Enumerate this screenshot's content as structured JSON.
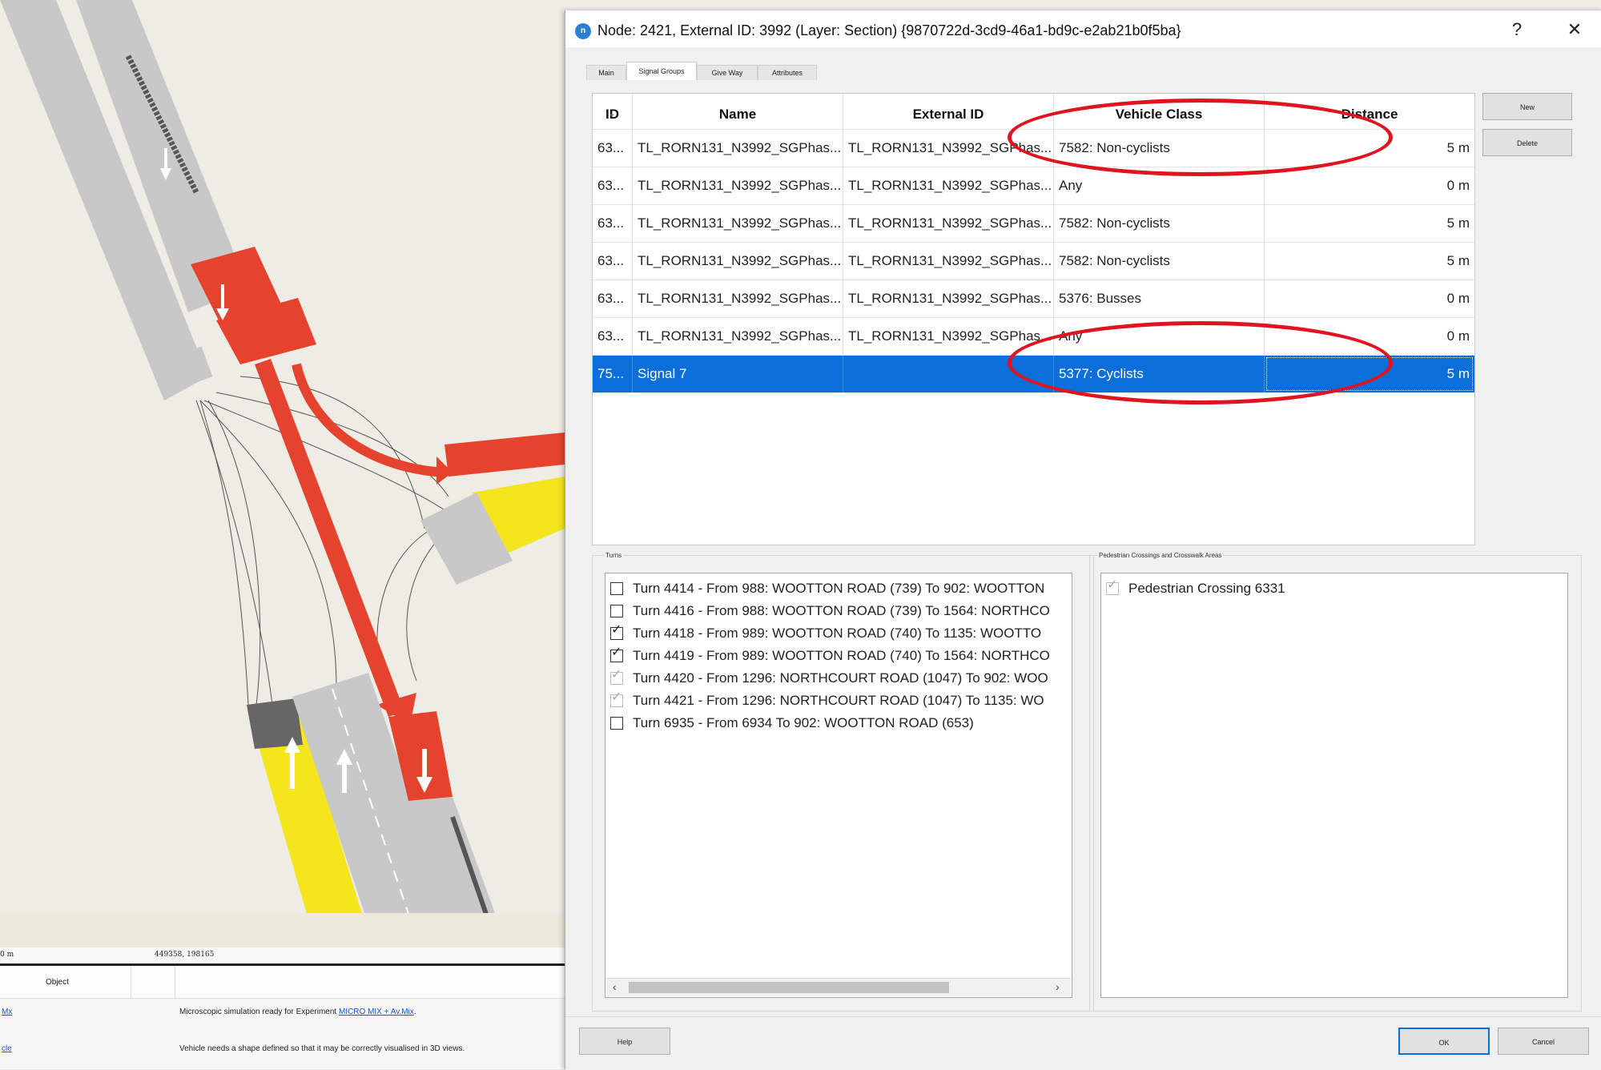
{
  "map": {
    "scale_label": "0 m",
    "coordinates": "449358, 198165"
  },
  "log": {
    "header_object": "Object",
    "rows": [
      {
        "link": "Mx",
        "message": "Microscopic simulation ready for Experiment",
        "message_link": "MICRO MIX + Av.Mix"
      },
      {
        "link": "cle",
        "message": "Vehicle needs a shape defined so that it may be correctly visualised in 3D views.",
        "message_link": ""
      }
    ]
  },
  "dialog": {
    "icon": "n",
    "title": "Node: 2421, External ID: 3992 (Layer: Section) {9870722d-3cd9-46a1-bd9c-e2ab21b0f5ba}",
    "help_label": "?",
    "close_label": "✕",
    "tabs": [
      "Main",
      "Signal Groups",
      "Give Way",
      "Attributes"
    ],
    "active_tab": "Signal Groups",
    "table": {
      "columns": [
        "ID",
        "Name",
        "External ID",
        "Vehicle Class",
        "Distance"
      ],
      "rows": [
        {
          "id": "63...",
          "name": "TL_RORN131_N3992_SGPhas...",
          "external": "TL_RORN131_N3992_SGPhas...",
          "vclass": "7582: Non-cyclists",
          "distance": "5 m",
          "selected": false
        },
        {
          "id": "63...",
          "name": "TL_RORN131_N3992_SGPhas...",
          "external": "TL_RORN131_N3992_SGPhas...",
          "vclass": "Any",
          "distance": "0 m",
          "selected": false
        },
        {
          "id": "63...",
          "name": "TL_RORN131_N3992_SGPhas...",
          "external": "TL_RORN131_N3992_SGPhas...",
          "vclass": "7582: Non-cyclists",
          "distance": "5 m",
          "selected": false
        },
        {
          "id": "63...",
          "name": "TL_RORN131_N3992_SGPhas...",
          "external": "TL_RORN131_N3992_SGPhas...",
          "vclass": "7582: Non-cyclists",
          "distance": "5 m",
          "selected": false
        },
        {
          "id": "63...",
          "name": "TL_RORN131_N3992_SGPhas...",
          "external": "TL_RORN131_N3992_SGPhas...",
          "vclass": "5376: Busses",
          "distance": "0 m",
          "selected": false
        },
        {
          "id": "63...",
          "name": "TL_RORN131_N3992_SGPhas...",
          "external": "TL_RORN131_N3992_SGPhas...",
          "vclass": "Any",
          "distance": "0 m",
          "selected": false
        },
        {
          "id": "75...",
          "name": "Signal 7",
          "external": "",
          "vclass": "5377: Cyclists",
          "distance": "5 m",
          "selected": true
        }
      ]
    },
    "buttons": {
      "new": "New",
      "delete": "Delete",
      "help": "Help",
      "ok": "OK",
      "cancel": "Cancel"
    },
    "turns": {
      "label": "Turns",
      "items": [
        {
          "text": "Turn 4414 - From 988: WOOTTON ROAD (739) To 902: WOOTTON",
          "state": "unchecked"
        },
        {
          "text": "Turn 4416 - From 988: WOOTTON ROAD (739) To 1564: NORTHCO",
          "state": "unchecked"
        },
        {
          "text": "Turn 4418 - From 989: WOOTTON ROAD (740) To 1135: WOOTTO",
          "state": "checked"
        },
        {
          "text": "Turn 4419 - From 989: WOOTTON ROAD (740) To 1564: NORTHCO",
          "state": "checked"
        },
        {
          "text": "Turn 4420 - From 1296: NORTHCOURT ROAD (1047) To 902: WOO",
          "state": "checked-disabled"
        },
        {
          "text": "Turn 4421 - From 1296: NORTHCOURT ROAD (1047) To 1135: WO",
          "state": "checked-disabled"
        },
        {
          "text": "Turn 6935 - From 6934 To 902: WOOTTON ROAD (653)",
          "state": "unchecked"
        }
      ]
    },
    "pedestrian": {
      "label": "Pedestrian Crossings and Crosswalk Areas",
      "items": [
        {
          "text": "Pedestrian Crossing 6331",
          "state": "checked-disabled"
        }
      ]
    },
    "annotation_color": "#e0141f",
    "selection_color": "#0a6fd8"
  }
}
